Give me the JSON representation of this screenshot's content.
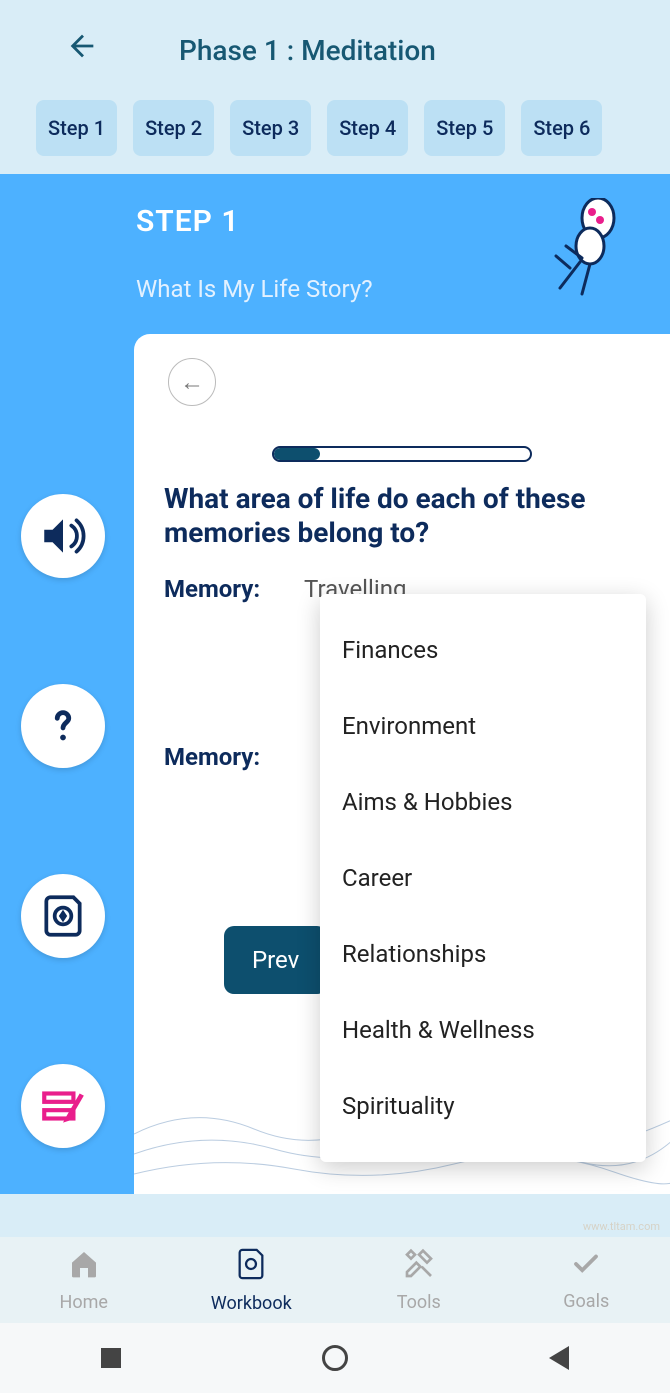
{
  "header": {
    "title": "Phase 1 : Meditation"
  },
  "steps": [
    "Step 1",
    "Step 2",
    "Step 3",
    "Step 4",
    "Step 5",
    "Step 6"
  ],
  "step_header": {
    "num": "STEP 1",
    "q": "What Is My Life Story?"
  },
  "card": {
    "question": "What area of life do each of these memories belong to?",
    "memory_label": "Memory:",
    "memory1_value": "Travelling",
    "memory2_value": "",
    "prev": "Prev"
  },
  "dropdown": [
    "Finances",
    "Environment",
    "Aims & Hobbies",
    "Career",
    "Relationships",
    "Health & Wellness",
    "Spirituality"
  ],
  "tabs": {
    "home": "Home",
    "workbook": "Workbook",
    "tools": "Tools",
    "goals": "Goals"
  },
  "watermark": "www.tltam.com"
}
